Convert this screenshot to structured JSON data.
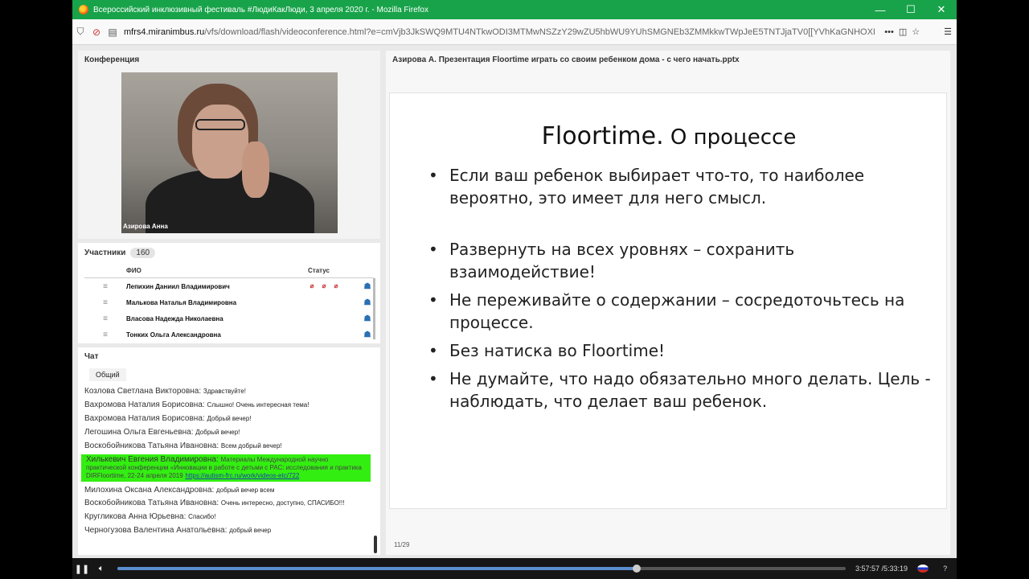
{
  "window": {
    "title": "Всероссийский инклюзивный фестиваль #ЛюдиКакЛюди, 3 апреля 2020 г. - Mozilla Firefox",
    "controls": {
      "minimize": "—",
      "maximize": "☐",
      "close": "✕"
    }
  },
  "browser": {
    "url_domain": "mfrs4.miranimbus.ru",
    "url_path": "/vfs/download/flash/videoconference.html?e=cmVjb3JkSWQ9MTU4NTkwODI3MTMwNSZzY29wZU5hbWU9YUhSMGNEb3ZMMkkwTWpJeE5TNTJjaTV0[[YVhKaGNHOXI",
    "more_label": "•••"
  },
  "conference": {
    "title": "Конференция",
    "video_caption": "Азирова Анна"
  },
  "participants": {
    "title": "Участники",
    "count": "160",
    "col_name": "ФИО",
    "col_status": "Статус",
    "rows": [
      {
        "name": "Лепихин Даниил Владимирович",
        "has_media_icons": true
      },
      {
        "name": "Малькова Наталья Владимировна",
        "has_media_icons": false
      },
      {
        "name": "Власова Надежда Николаевна",
        "has_media_icons": false
      },
      {
        "name": "Тонких Ольга Александровна",
        "has_media_icons": false
      }
    ]
  },
  "chat": {
    "title": "Чат",
    "tab": "Общий",
    "highlight_color": "#33ee11",
    "messages": [
      {
        "author": "Козлова Светлана Викторовна:",
        "text": "Здравствуйте!"
      },
      {
        "author": "Вахромова Наталия Борисовна:",
        "text": "Слышно! Очень интересная тема!"
      },
      {
        "author": "Вахромова Наталия Борисовна:",
        "text": "Добрый вечер!"
      },
      {
        "author": "Легошина Ольга Евгеньевна:",
        "text": "Добрый вечер!"
      },
      {
        "author": "Воскобойникова Татьяна Ивановна:",
        "text": "Всем добрый вечер!"
      },
      {
        "author": "Хилькевич Евгения Владимировна:",
        "text": "Материалы Международной научно практической конференции «Инновации в работе с детьми с РАС: исследования и практика DIRFloortime, 22-24 апреля 2019",
        "link": "https://autism-frc.ru/work/videos-etc/722",
        "highlight": true
      },
      {
        "author": "Милохина Оксана Александровна:",
        "text": "добрый вечер всем"
      },
      {
        "author": "Воскобойникова Татьяна Ивановна:",
        "text": "Очень интересно, доступно, СПАСИБО!!!"
      },
      {
        "author": "Кругликова Анна Юрьевна:",
        "text": "Спасибо!"
      },
      {
        "author": "Черногузова Валентина Анатольевна:",
        "text": "добрый вечер"
      }
    ]
  },
  "presentation": {
    "header": "Азирова А. Презентация Floortime  играть со своим ребенком дома - с чего начать.pptx",
    "slide_title_main": "Floortime.",
    "slide_title_rest": " О процессе",
    "bullets": [
      "Если ваш ребенок выбирает что-то, то наиболее вероятно, это имеет для него смысл.",
      "Развернуть на всех уровнях – сохранить взаимодействие!",
      "Не переживайте о содержании – сосредоточьтесь на процессе.",
      "Без натиска во Floortime!",
      "Не думайте, что надо обязательно много делать. Цель - наблюдать, что делает ваш ребенок."
    ],
    "page": "11/29"
  },
  "player": {
    "time": "3:57:57 /5:33:19",
    "progress": 0.713,
    "help": "?"
  }
}
